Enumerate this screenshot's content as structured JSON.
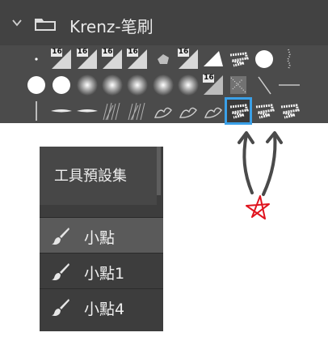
{
  "brush_panel": {
    "folder_name": "Krenz-笔刷",
    "icons": {
      "collapse": "chevron-down-icon",
      "folder": "folder-icon"
    },
    "brush_size_badge": "16",
    "selected_brush_index": 30,
    "accent_color": "#3aa0e8"
  },
  "tool_presets": {
    "title": "工具預設集",
    "items": [
      {
        "label": "小點",
        "icon": "brush-icon",
        "highlighted": true
      },
      {
        "label": "小點1",
        "icon": "brush-icon",
        "highlighted": false
      },
      {
        "label": "小點4",
        "icon": "brush-icon",
        "highlighted": false
      }
    ]
  },
  "annotation": {
    "color_arrows": "#4a4a4a",
    "color_star": "#e0141e"
  }
}
